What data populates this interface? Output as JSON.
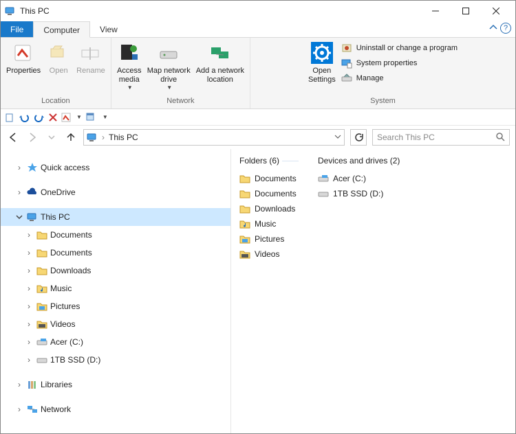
{
  "window": {
    "title": "This PC"
  },
  "tabs": {
    "file": "File",
    "computer": "Computer",
    "view": "View"
  },
  "ribbon": {
    "location": {
      "group": "Location",
      "properties": "Properties",
      "open": "Open",
      "rename": "Rename"
    },
    "network": {
      "group": "Network",
      "access_media": "Access\nmedia",
      "map_drive": "Map network\ndrive",
      "add_location": "Add a network\nlocation"
    },
    "system": {
      "group": "System",
      "open_settings": "Open\nSettings",
      "uninstall": "Uninstall or change a program",
      "sysprops": "System properties",
      "manage": "Manage"
    }
  },
  "address": {
    "location": "This PC"
  },
  "search": {
    "placeholder": "Search This PC"
  },
  "nav": {
    "quick_access": "Quick access",
    "onedrive": "OneDrive",
    "this_pc": "This PC",
    "documents": "Documents",
    "documents2": "Documents",
    "downloads": "Downloads",
    "music": "Music",
    "pictures": "Pictures",
    "videos": "Videos",
    "acer": "Acer (C:)",
    "ssd": "1TB SSD (D:)",
    "libraries": "Libraries",
    "network": "Network"
  },
  "content": {
    "folders_header": "Folders (6)",
    "drives_header": "Devices and drives (2)",
    "folders": {
      "documents": "Documents",
      "documents2": "Documents",
      "downloads": "Downloads",
      "music": "Music",
      "pictures": "Pictures",
      "videos": "Videos"
    },
    "drives": {
      "acer": "Acer (C:)",
      "ssd": "1TB SSD (D:)"
    }
  }
}
